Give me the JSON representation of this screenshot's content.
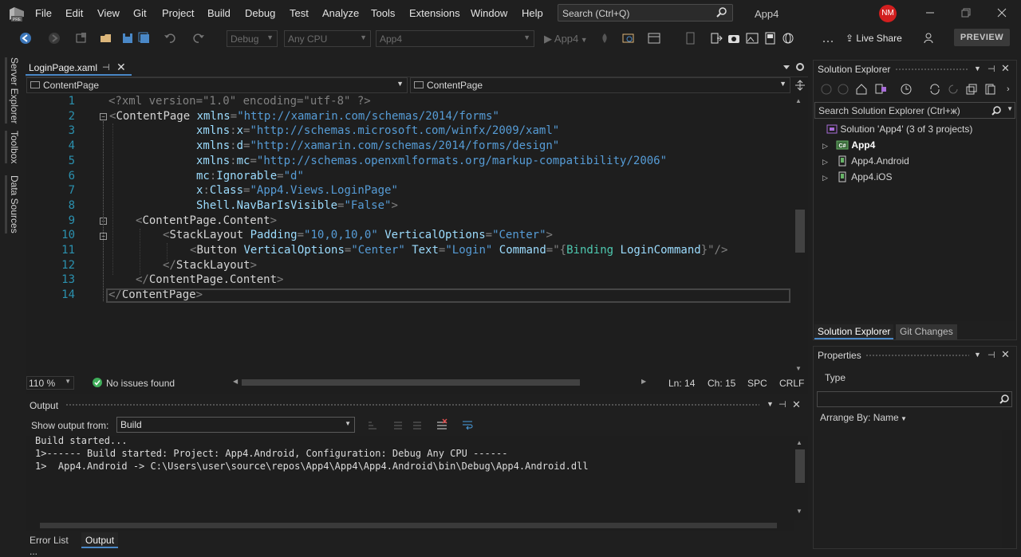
{
  "menubar": {
    "items": [
      "File",
      "Edit",
      "View",
      "Git",
      "Project",
      "Build",
      "Debug",
      "Test",
      "Analyze",
      "Tools",
      "Extensions",
      "Window",
      "Help"
    ],
    "search_placeholder": "Search (Ctrl+Q)",
    "app_title": "App4",
    "user_initials": "NM"
  },
  "toolbar": {
    "config": "Debug",
    "platform": "Any CPU",
    "startup_project": "App4",
    "run_target": "App4",
    "live_share": "Live Share",
    "preview": "PREVIEW"
  },
  "left_tabs": [
    "Server Explorer",
    "Toolbox",
    "Data Sources"
  ],
  "editor": {
    "tab_name": "LoginPage.xaml",
    "nav_left": "ContentPage",
    "nav_right": "ContentPage",
    "line_numbers": [
      "1",
      "2",
      "3",
      "4",
      "5",
      "6",
      "7",
      "8",
      "9",
      "10",
      "11",
      "12",
      "13",
      "14"
    ],
    "lines": [
      [
        [
          "xbr",
          "<?xml version=\"1.0\" encoding=\"utf-8\" ?>"
        ]
      ],
      [
        [
          "xbr",
          "<"
        ],
        [
          "xname",
          "ContentPage "
        ],
        [
          "xattr",
          "xmlns"
        ],
        [
          "xbr",
          "="
        ],
        [
          "xtag",
          "\"http://xamarin.com/schemas/2014/forms\""
        ]
      ],
      [
        [
          "xattr",
          "xmlns"
        ],
        [
          "xbr",
          ":"
        ],
        [
          "xattr",
          "x"
        ],
        [
          "xbr",
          "="
        ],
        [
          "xtag",
          "\"http://schemas.microsoft.com/winfx/2009/xaml\""
        ]
      ],
      [
        [
          "xattr",
          "xmlns"
        ],
        [
          "xbr",
          ":"
        ],
        [
          "xattr",
          "d"
        ],
        [
          "xbr",
          "="
        ],
        [
          "xtag",
          "\"http://xamarin.com/schemas/2014/forms/design\""
        ]
      ],
      [
        [
          "xattr",
          "xmlns"
        ],
        [
          "xbr",
          ":"
        ],
        [
          "xattr",
          "mc"
        ],
        [
          "xbr",
          "="
        ],
        [
          "xtag",
          "\"http://schemas.openxmlformats.org/markup-compatibility/2006\""
        ]
      ],
      [
        [
          "xattr",
          "mc"
        ],
        [
          "xbr",
          ":"
        ],
        [
          "xattr",
          "Ignorable"
        ],
        [
          "xbr",
          "="
        ],
        [
          "xtag",
          "\"d\""
        ]
      ],
      [
        [
          "xattr",
          "x"
        ],
        [
          "xbr",
          ":"
        ],
        [
          "xattr",
          "Class"
        ],
        [
          "xbr",
          "="
        ],
        [
          "xtag",
          "\"App4.Views.LoginPage\""
        ]
      ],
      [
        [
          "xattr",
          "Shell.NavBarIsVisible"
        ],
        [
          "xbr",
          "="
        ],
        [
          "xtag",
          "\"False\""
        ],
        [
          "xbr",
          ">"
        ]
      ],
      [
        [
          "xbr",
          "<"
        ],
        [
          "xname",
          "ContentPage.Content"
        ],
        [
          "xbr",
          ">"
        ]
      ],
      [
        [
          "xbr",
          "<"
        ],
        [
          "xname",
          "StackLayout "
        ],
        [
          "xattr",
          "Padding"
        ],
        [
          "xbr",
          "="
        ],
        [
          "xtag",
          "\"10,0,10,0\" "
        ],
        [
          "xattr",
          "VerticalOptions"
        ],
        [
          "xbr",
          "="
        ],
        [
          "xtag",
          "\"Center\""
        ],
        [
          "xbr",
          ">"
        ]
      ],
      [
        [
          "xbr",
          "<"
        ],
        [
          "xname",
          "Button "
        ],
        [
          "xattr",
          "VerticalOptions"
        ],
        [
          "xbr",
          "="
        ],
        [
          "xtag",
          "\"Center\" "
        ],
        [
          "xattr",
          "Text"
        ],
        [
          "xbr",
          "="
        ],
        [
          "xtag",
          "\"Login\" "
        ],
        [
          "xattr",
          "Command"
        ],
        [
          "xbr",
          "=\"{"
        ],
        [
          "xval",
          "Binding "
        ],
        [
          "xattr",
          "LoginCommand"
        ],
        [
          "xbr",
          "}\"/>"
        ]
      ],
      [
        [
          "xbr",
          "</"
        ],
        [
          "xname",
          "StackLayout"
        ],
        [
          "xbr",
          ">"
        ]
      ],
      [
        [
          "xbr",
          "</"
        ],
        [
          "xname",
          "ContentPage.Content"
        ],
        [
          "xbr",
          ">"
        ]
      ],
      [
        [
          "xbr",
          "</"
        ],
        [
          "xname",
          "ContentPage"
        ],
        [
          "xbr",
          ">"
        ]
      ]
    ],
    "zoom": "110 %",
    "issues": "No issues found",
    "ln": "Ln: 14",
    "ch": "Ch: 15",
    "spc": "SPC",
    "crlf": "CRLF"
  },
  "output": {
    "title": "Output",
    "show_from_label": "Show output from:",
    "source": "Build",
    "lines": [
      "Build started...",
      "1>------ Build started: Project: App4.Android, Configuration: Debug Any CPU ------",
      "1>  App4.Android -> C:\\Users\\user\\source\\repos\\App4\\App4\\App4.Android\\bin\\Debug\\App4.Android.dll"
    ]
  },
  "bottom_tabs": [
    "Error List ...",
    "Output"
  ],
  "solution_explorer": {
    "title": "Solution Explorer",
    "search_placeholder": "Search Solution Explorer (Ctrl+ж)",
    "solution": "Solution 'App4' (3 of 3 projects)",
    "projects": [
      "App4",
      "App4.Android",
      "App4.iOS"
    ],
    "tabs": [
      "Solution Explorer",
      "Git Changes"
    ]
  },
  "properties": {
    "title": "Properties",
    "type_label": "Type",
    "arrange": "Arrange By: Name"
  },
  "colors": {
    "accent": "#4a88c7",
    "avatar": "#d21f1f",
    "line_numbers": "#2b91af"
  }
}
